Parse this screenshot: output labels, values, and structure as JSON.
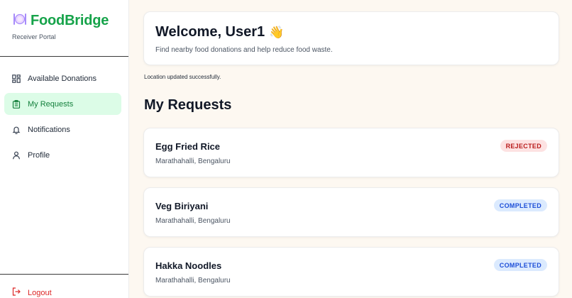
{
  "brand": {
    "name": "FoodBridge",
    "subtitle": "Receiver Portal",
    "logo_icon": "plate-cutlery-icon"
  },
  "nav": {
    "items": [
      {
        "label": "Available Donations",
        "icon": "grid-icon",
        "active": false
      },
      {
        "label": "My Requests",
        "icon": "clipboard-icon",
        "active": true
      },
      {
        "label": "Notifications",
        "icon": "bell-icon",
        "active": false
      },
      {
        "label": "Profile",
        "icon": "user-icon",
        "active": false
      }
    ],
    "logout_label": "Logout"
  },
  "welcome": {
    "title": "Welcome, User1",
    "emoji": "👋",
    "subtitle": "Find nearby food donations and help reduce food waste."
  },
  "status_message": "Location updated successfully.",
  "section_title": "My Requests",
  "requests": [
    {
      "name": "Egg Fried Rice",
      "location": "Marathahalli, Bengaluru",
      "status": "REJECTED"
    },
    {
      "name": "Veg Biriyani",
      "location": "Marathahalli, Bengaluru",
      "status": "COMPLETED"
    },
    {
      "name": "Hakka Noodles",
      "location": "Marathahalli, Bengaluru",
      "status": "COMPLETED"
    }
  ],
  "colors": {
    "brand": "#16a34a",
    "active_bg": "#dcfce7",
    "rejected": "#b91c1c",
    "completed": "#1d4ed8",
    "logout": "#dc2626"
  }
}
